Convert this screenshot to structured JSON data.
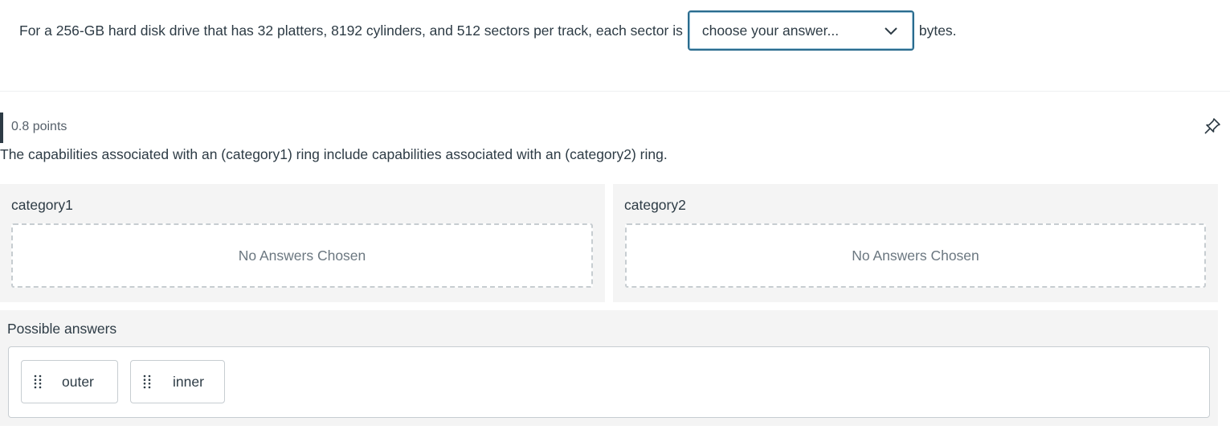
{
  "question1": {
    "text_before": "For a 256-GB hard disk drive that has 32 platters, 8192 cylinders, and 512 sectors per track, each sector is",
    "select_value": "choose your answer...",
    "text_after": "bytes."
  },
  "question2": {
    "points": "0.8 points",
    "prompt": "The capabilities associated with an (category1) ring include capabilities associated with an (category2) ring.",
    "categories": [
      {
        "label": "category1",
        "dropzone_text": "No Answers Chosen"
      },
      {
        "label": "category2",
        "dropzone_text": "No Answers Chosen"
      }
    ],
    "possible_answers_label": "Possible answers",
    "answers": [
      "outer",
      "inner"
    ]
  },
  "icons": {
    "select": "chevron-down-icon",
    "pin": "pin-icon",
    "chip": "drag-handle-icon"
  },
  "colors": {
    "text": "#2d3b45",
    "select_border": "#2b6c8e",
    "panel_bg": "#f4f4f4"
  }
}
